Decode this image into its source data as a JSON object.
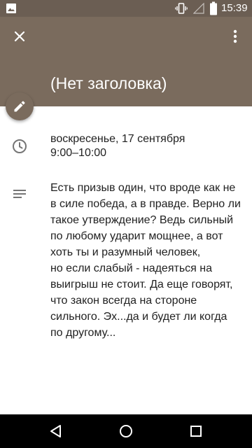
{
  "status_bar": {
    "time": "15:39"
  },
  "header": {
    "title": "(Нет заголовка)"
  },
  "event": {
    "date": "воскресенье, 17 сентября",
    "time_range": "9:00–10:00",
    "description": "Есть призыв один, что вроде как не\nв силе победа, а в правде. Верно ли\nтакое утверждение? Ведь сильный\nпо любому ударит мощнее, а вот\nхоть ты и разумный человек,\nно если слабый - надеяться на\nвыигрыш не стоит. Да еще говорят,\nчто закон всегда на стороне\nсильного. Эх...да и будет ли когда\nпо другому..."
  },
  "icons": {
    "status_left": "image-icon",
    "vibrate": "vibrate-icon",
    "signal": "signal-icon",
    "battery": "battery-icon",
    "close": "close-icon",
    "more": "more-vert-icon",
    "edit": "pencil-icon",
    "time": "clock-icon",
    "notes": "notes-icon",
    "back": "back-icon",
    "home": "home-icon",
    "recents": "recents-icon"
  },
  "colors": {
    "header": "#7a6b5d",
    "status_bar": "#6b5e53",
    "nav_bar": "#000000",
    "icon_gray": "#757575"
  }
}
